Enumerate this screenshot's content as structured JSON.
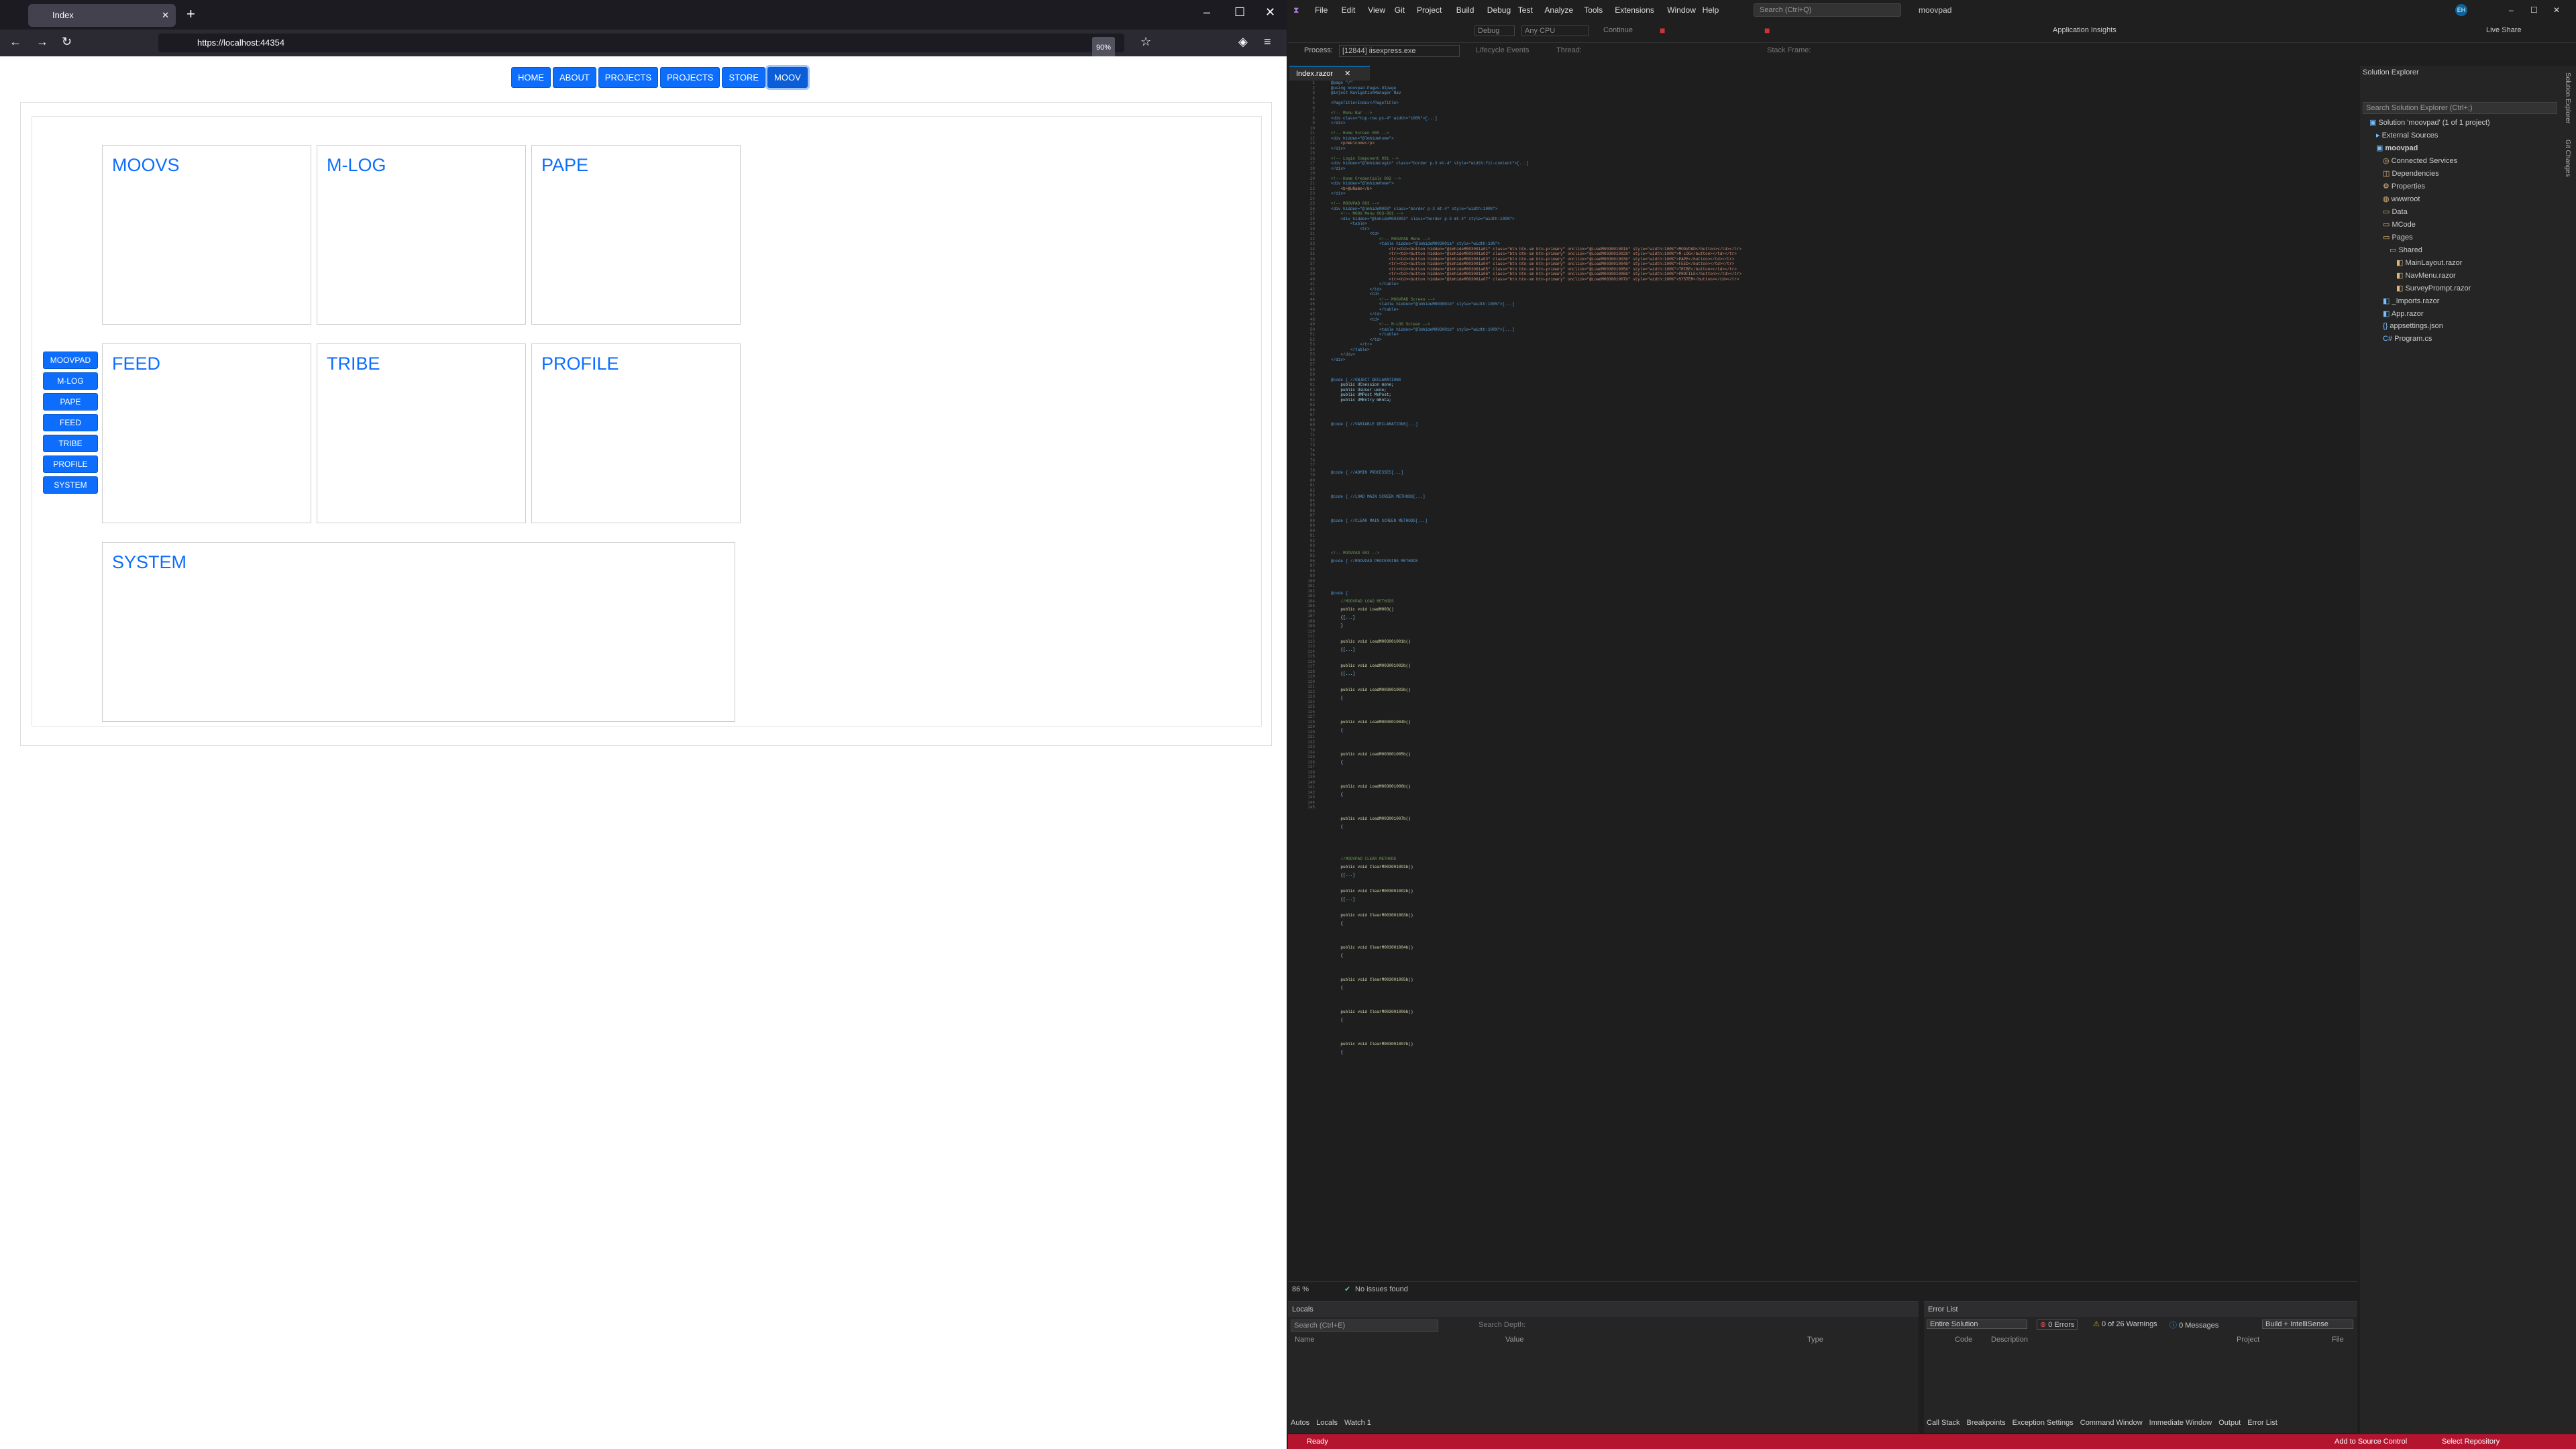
{
  "browser": {
    "tab_title": "Index",
    "url": "https://localhost:44354",
    "zoom": "90%"
  },
  "page": {
    "top_nav": [
      "HOME",
      "ABOUT",
      "PROJECTS",
      "PROJECTS",
      "STORE",
      "MOOV"
    ],
    "active_top": "MOOV",
    "side_menu": [
      "MOOVPAD",
      "M-LOG",
      "PAPE",
      "FEED",
      "TRIBE",
      "PROFILE",
      "SYSTEM"
    ],
    "cards": [
      "MOOVS",
      "M-LOG",
      "PAPE",
      "FEED",
      "TRIBE",
      "PROFILE",
      "SYSTEM"
    ]
  },
  "vs": {
    "menu": [
      "File",
      "Edit",
      "View",
      "Git",
      "Project",
      "Build",
      "Debug",
      "Test",
      "Analyze",
      "Tools",
      "Extensions",
      "Window",
      "Help"
    ],
    "search_placeholder": "Search (Ctrl+Q)",
    "solution_name": "moovpad",
    "toolbar": {
      "config": "Debug",
      "platform": "Any CPU",
      "continue": "Continue",
      "insights": "Application Insights",
      "live_share": "Live Share"
    },
    "process": {
      "label": "Process:",
      "value": "[12844] iisexpress.exe",
      "lifecycle": "Lifecycle Events",
      "thread": "Thread:",
      "stack": "Stack Frame:"
    },
    "doc_tab": "Index.razor",
    "editor_status": {
      "zoom": "86 %",
      "issues": "No issues found"
    },
    "locals": {
      "title": "Locals",
      "search": "Search (Ctrl+E)",
      "depth": "Search Depth:",
      "columns": [
        "Name",
        "Value",
        "Type"
      ],
      "tabs": [
        "Autos",
        "Locals",
        "Watch 1"
      ]
    },
    "errors": {
      "title": "Error List",
      "scope": "Entire Solution",
      "errors": "0 Errors",
      "warnings": "0 of 26 Warnings",
      "messages": "0 Messages",
      "build": "Build + IntelliSense",
      "columns": [
        "Code",
        "Description",
        "Project",
        "File"
      ],
      "tabs": [
        "Call Stack",
        "Breakpoints",
        "Exception Settings",
        "Command Window",
        "Immediate Window",
        "Output",
        "Error List"
      ]
    },
    "solution_explorer": {
      "title": "Solution Explorer",
      "search": "Search Solution Explorer (Ctrl+;)",
      "items": [
        "Solution 'moovpad' (1 of 1 project)",
        "External Sources",
        "moovpad",
        "Connected Services",
        "Dependencies",
        "Properties",
        "wwwroot",
        "Data",
        "MCode",
        "Pages",
        "Shared",
        "MainLayout.razor",
        "NavMenu.razor",
        "SurveyPrompt.razor",
        "_Imports.razor",
        "App.razor",
        "appsettings.json",
        "Program.cs"
      ],
      "side_tabs": [
        "Solution Explorer",
        "Git Changes"
      ]
    },
    "status": {
      "ready": "Ready",
      "source": "Add to Source Control",
      "repo": "Select Repository"
    },
    "code_lines": [
      [
        "k",
        "@page \"/\""
      ],
      [
        "k",
        "@using moovpad.Pages.UIpage"
      ],
      [
        "k",
        "@inject NavigationManager Nav"
      ],
      [
        "",
        ""
      ],
      [
        "tg",
        "<PageTitle>Index</PageTitle>"
      ],
      [
        "",
        ""
      ],
      [
        "c",
        "<!-- Menu Bar -->"
      ],
      [
        "tg",
        "<div class=\"top-row px-4\" width=\"100%\">[...]"
      ],
      [
        "tg",
        "</div>"
      ],
      [
        "",
        ""
      ],
      [
        "c",
        "<!-- Home Screen 000 -->"
      ],
      [
        "tg",
        "<div hidden=\"@lmhidehome\">"
      ],
      [
        "s",
        "    <p>Welcome</p>"
      ],
      [
        "tg",
        "</div>"
      ],
      [
        "",
        ""
      ],
      [
        "c",
        "<!-- Login Component 001 -->"
      ],
      [
        "tg",
        "<div hidden=\"@lmhideLogin\" class=\"border p-3 mt-4\" style=\"width:fit-content\">[...]"
      ],
      [
        "tg",
        "</div>"
      ],
      [
        "",
        ""
      ],
      [
        "c",
        "<!-- Home Credentials 002 -->"
      ],
      [
        "tg",
        "<div hidden=\"@lmhideHome\">"
      ],
      [
        "s",
        "    <b>@uName</b>"
      ],
      [
        "tg",
        "</div>"
      ],
      [
        "",
        ""
      ],
      [
        "c",
        "<!-- MOOVPAD 003 -->"
      ],
      [
        "tg",
        "<div hidden=\"@lmhideM003\" class=\"border p-3 mt-4\" style=\"width:100%\">"
      ],
      [
        "c",
        "    <!-- MOOV Menu 003-001 -->"
      ],
      [
        "tg",
        "    <div hidden=\"@lmhideM003001\" class=\"border p-3 mt-4\" style=\"width:100%\">"
      ],
      [
        "tg",
        "        <table>"
      ],
      [
        "tg",
        "            <tr>"
      ],
      [
        "tg",
        "                <td>"
      ],
      [
        "c",
        "                    <!-- MOOVPAD Menu -->"
      ],
      [
        "tg",
        "                    <table hidden=\"@lmhideM003001a\" style=\"width:10%\">"
      ],
      [
        "s",
        "                        <tr><td><button hidden=\"@lmhideM003001a01\" class=\"btn btn-sm btn-primary\" onclick=\"@LoadM003001001b\" style=\"width:100%\">MOOVPAD</button></td></tr>"
      ],
      [
        "s",
        "                        <tr><td><button hidden=\"@lmhideM003001a02\" class=\"btn btn-sm btn-primary\" onclick=\"@LoadM003001002b\" style=\"width:100%\">M-LOG</button></td></tr>"
      ],
      [
        "s",
        "                        <tr><td><button hidden=\"@lmhideM003001a03\" class=\"btn btn-sm btn-primary\" onclick=\"@LoadM003001003b\" style=\"width:100%\">PAPE</button></td></tr>"
      ],
      [
        "s",
        "                        <tr><td><button hidden=\"@lmhideM003001a04\" class=\"btn btn-sm btn-primary\" onclick=\"@LoadM003001004b\" style=\"width:100%\">FEED</button></td></tr>"
      ],
      [
        "s",
        "                        <tr><td><button hidden=\"@lmhideM003001a05\" class=\"btn btn-sm btn-primary\" onclick=\"@LoadM003001005b\" style=\"width:100%\">TRIBE</button></td></tr>"
      ],
      [
        "s",
        "                        <tr><td><button hidden=\"@lmhideM003001a06\" class=\"btn btn-sm btn-primary\" onclick=\"@LoadM003001006b\" style=\"width:100%\">PROFILE</button></td></tr>"
      ],
      [
        "s",
        "                        <tr><td><button hidden=\"@lmhideM003001a07\" class=\"btn btn-sm btn-primary\" onclick=\"@LoadM003001007b\" style=\"width:100%\">SYSTEM</button></td></tr>"
      ],
      [
        "tg",
        "                    </table>"
      ],
      [
        "tg",
        "                </td>"
      ],
      [
        "tg",
        "                <td>"
      ],
      [
        "c",
        "                    <!-- MOOVPAD Screen -->"
      ],
      [
        "tg",
        "                    <table hidden=\"@lmhideM003001b\" style=\"width:100%\">[...]"
      ],
      [
        "tg",
        "                    </table>"
      ],
      [
        "tg",
        "                </td>"
      ],
      [
        "tg",
        "                <td>"
      ],
      [
        "c",
        "                    <!-- M-LOG Screen -->"
      ],
      [
        "tg",
        "                    <table hidden=\"@lmhideM003001b\" style=\"width:100%\">[...]"
      ],
      [
        "tg",
        "                    </table>"
      ],
      [
        "tg",
        "                </td>"
      ],
      [
        "tg",
        "            </tr>"
      ],
      [
        "tg",
        "        </table>"
      ],
      [
        "tg",
        "    </div>"
      ],
      [
        "tg",
        "</div>"
      ],
      [
        "",
        ""
      ],
      [
        "",
        ""
      ],
      [
        "",
        ""
      ],
      [
        "k",
        "@code { //OBJECT DECLARATIONS"
      ],
      [
        "",
        "    public UCsession mone;"
      ],
      [
        "",
        "    public UsUser uone;"
      ],
      [
        "",
        "    public UMPost MoPost;"
      ],
      [
        "",
        "    public UMEntry mEnta;"
      ],
      [
        "",
        ""
      ],
      [
        "",
        ""
      ],
      [
        "k",
        "@code { //VARIABLE DECLARATIONS[...]"
      ],
      [
        "",
        ""
      ],
      [
        "",
        ""
      ],
      [
        "",
        ""
      ],
      [
        "",
        ""
      ],
      [
        "",
        ""
      ],
      [
        "k",
        "@code { //ADMIN PROCESSES[...]"
      ],
      [
        "",
        ""
      ],
      [
        "",
        ""
      ],
      [
        "k",
        "@code { //LOAD MAIN SCREEN METHODS[...]"
      ],
      [
        "",
        ""
      ],
      [
        "",
        ""
      ],
      [
        "k",
        "@code { //CLEAR MAIN SCREEN METHODS[...]"
      ],
      [
        "",
        ""
      ],
      [
        "",
        ""
      ],
      [
        "",
        ""
      ],
      [
        "c",
        "<!-- MOOVPAD 003 -->"
      ],
      [
        "k",
        "@code { //MOOVPAD PROCESSING METHODS"
      ],
      [
        "",
        ""
      ],
      [
        "",
        ""
      ],
      [
        "",
        ""
      ],
      [
        "k",
        "@code {"
      ],
      [
        "c",
        "    //MOOVPAD LOAD METHODS"
      ],
      [
        "m",
        "    public void LoadM003()"
      ],
      [
        "",
        "    {[...]"
      ],
      [
        "",
        "    }"
      ],
      [
        "",
        ""
      ],
      [
        "m",
        "    public void LoadM003001001b()"
      ],
      [
        "",
        "    {[...]"
      ],
      [
        "",
        ""
      ],
      [
        "m",
        "    public void LoadM003001002b()"
      ],
      [
        "",
        "    {[...]"
      ],
      [
        "",
        ""
      ],
      [
        "m",
        "    public void LoadM003001003b()"
      ],
      [
        "",
        "    {"
      ],
      [
        "",
        ""
      ],
      [
        "",
        ""
      ],
      [
        "m",
        "    public void LoadM003001004b()"
      ],
      [
        "",
        "    {"
      ],
      [
        "",
        ""
      ],
      [
        "",
        ""
      ],
      [
        "m",
        "    public void LoadM003001005b()"
      ],
      [
        "",
        "    {"
      ],
      [
        "",
        ""
      ],
      [
        "",
        ""
      ],
      [
        "m",
        "    public void LoadM003001006b()"
      ],
      [
        "",
        "    {"
      ],
      [
        "",
        ""
      ],
      [
        "",
        ""
      ],
      [
        "m",
        "    public void LoadM003001007b()"
      ],
      [
        "",
        "    {"
      ],
      [
        "",
        ""
      ],
      [
        "",
        ""
      ],
      [
        "",
        ""
      ],
      [
        "c",
        "    //MOOVPAD CLEAR METHODS"
      ],
      [
        "m",
        "    public void ClearM003001001b()"
      ],
      [
        "",
        "    {[...]"
      ],
      [
        "",
        ""
      ],
      [
        "m",
        "    public void ClearM003001002b()"
      ],
      [
        "",
        "    {[...]"
      ],
      [
        "",
        ""
      ],
      [
        "m",
        "    public void ClearM003001003b()"
      ],
      [
        "",
        "    {"
      ],
      [
        "",
        ""
      ],
      [
        "",
        ""
      ],
      [
        "m",
        "    public void ClearM003001004b()"
      ],
      [
        "",
        "    {"
      ],
      [
        "",
        ""
      ],
      [
        "",
        ""
      ],
      [
        "m",
        "    public void ClearM003001005b()"
      ],
      [
        "",
        "    {"
      ],
      [
        "",
        ""
      ],
      [
        "",
        ""
      ],
      [
        "m",
        "    public void ClearM003001006b()"
      ],
      [
        "",
        "    {"
      ],
      [
        "",
        ""
      ],
      [
        "",
        ""
      ],
      [
        "m",
        "    public void ClearM003001007b()"
      ],
      [
        "",
        "    {"
      ]
    ]
  }
}
